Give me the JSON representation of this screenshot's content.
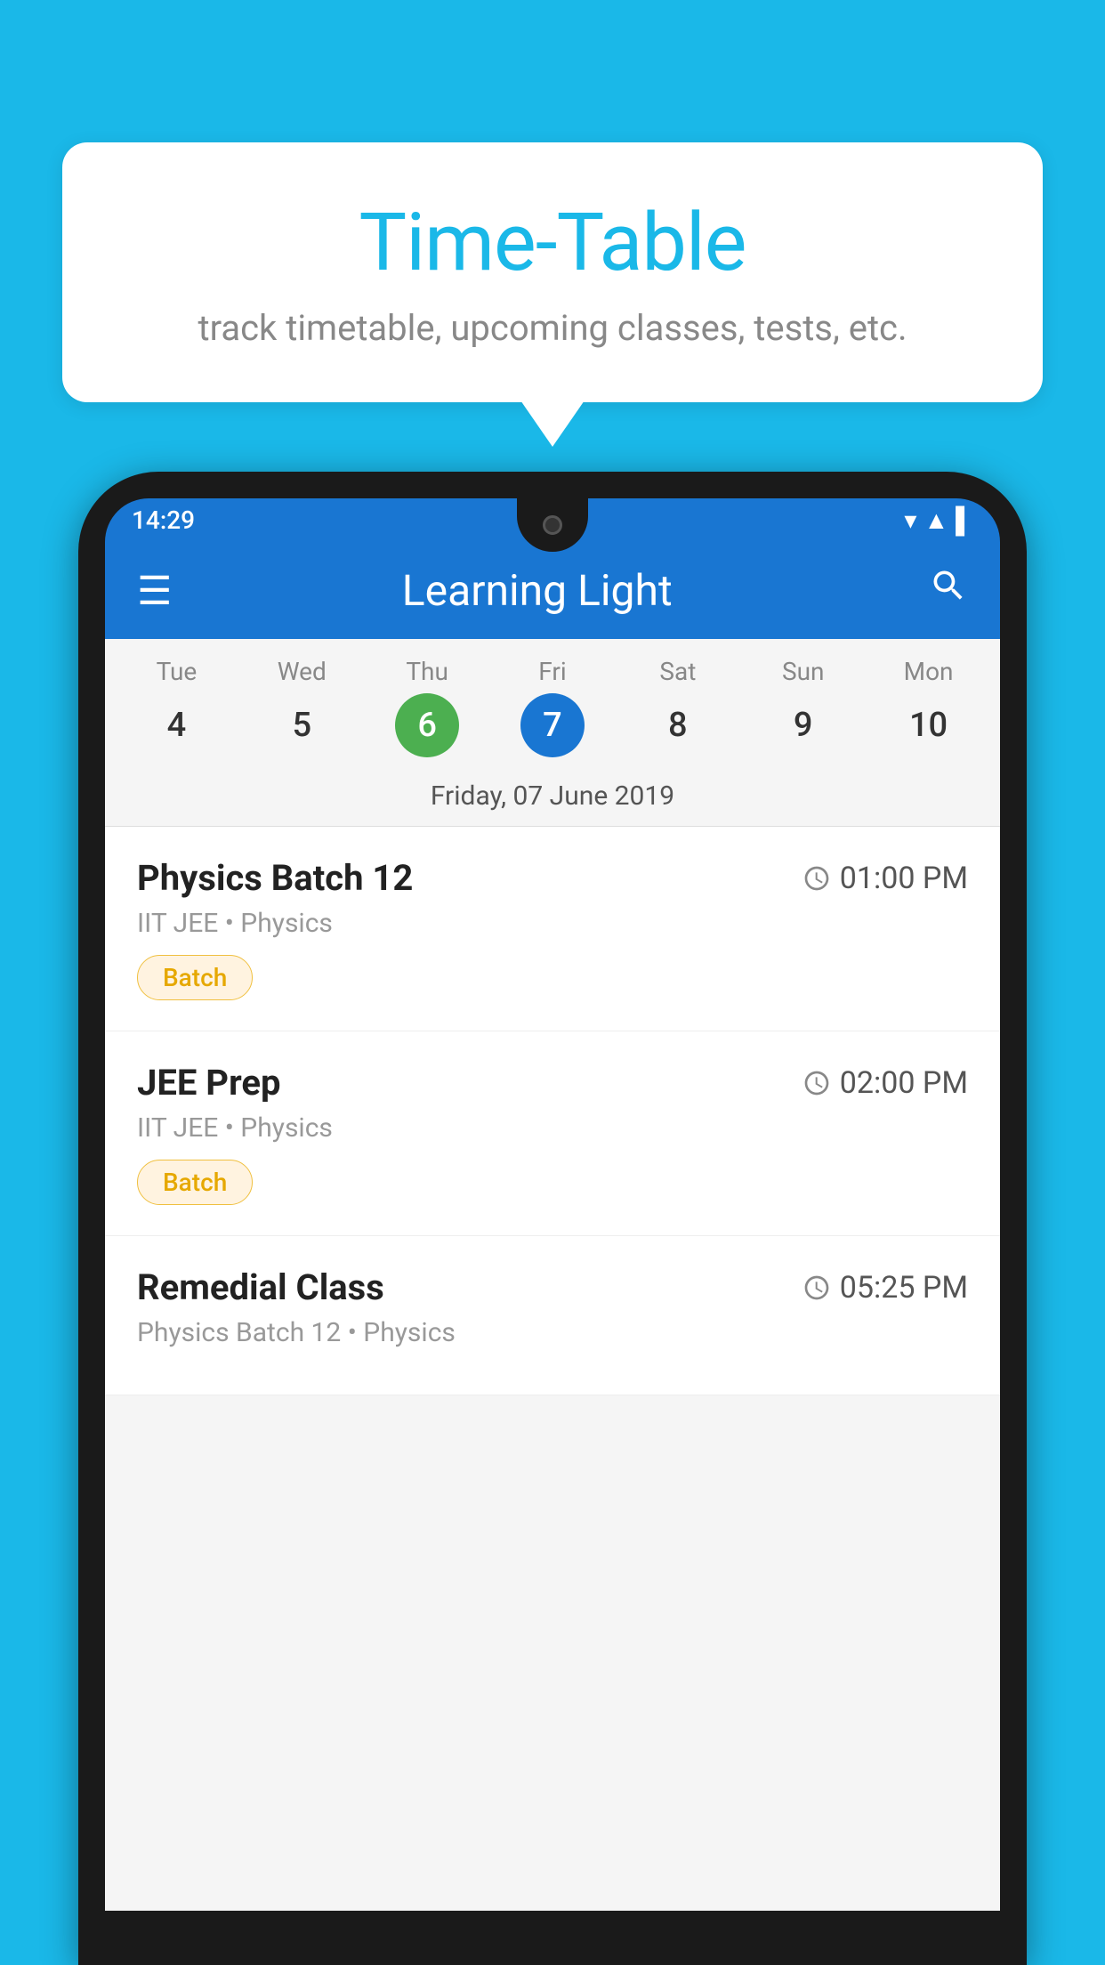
{
  "background_color": "#1ab8e8",
  "bubble": {
    "title": "Time-Table",
    "subtitle": "track timetable, upcoming classes, tests, etc."
  },
  "phone": {
    "status_bar": {
      "time": "14:29"
    },
    "toolbar": {
      "title": "Learning Light",
      "menu_icon": "≡",
      "search_icon": "🔍"
    },
    "week": {
      "days": [
        {
          "name": "Tue",
          "number": "4",
          "state": "normal"
        },
        {
          "name": "Wed",
          "number": "5",
          "state": "normal"
        },
        {
          "name": "Thu",
          "number": "6",
          "state": "today"
        },
        {
          "name": "Fri",
          "number": "7",
          "state": "selected"
        },
        {
          "name": "Sat",
          "number": "8",
          "state": "normal"
        },
        {
          "name": "Sun",
          "number": "9",
          "state": "normal"
        },
        {
          "name": "Mon",
          "number": "10",
          "state": "normal"
        }
      ],
      "selected_date_label": "Friday, 07 June 2019"
    },
    "schedule": [
      {
        "title": "Physics Batch 12",
        "time": "01:00 PM",
        "subtitle": "IIT JEE • Physics",
        "badge": "Batch"
      },
      {
        "title": "JEE Prep",
        "time": "02:00 PM",
        "subtitle": "IIT JEE • Physics",
        "badge": "Batch"
      },
      {
        "title": "Remedial Class",
        "time": "05:25 PM",
        "subtitle": "Physics Batch 12 • Physics",
        "badge": null
      }
    ]
  }
}
